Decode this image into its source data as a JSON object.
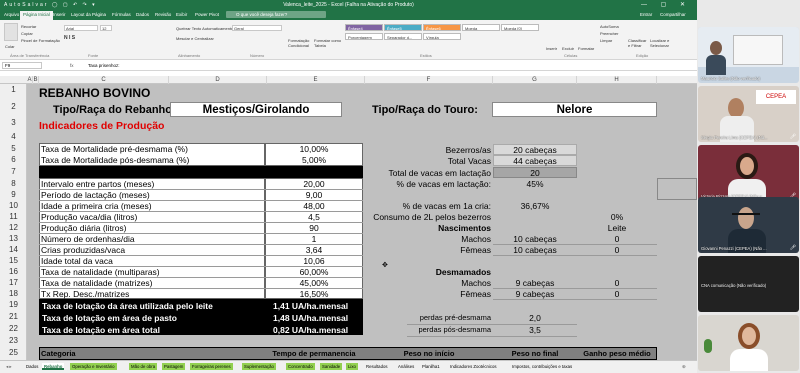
{
  "window": {
    "title": "Valenca_leite_2025 - Excel (Falha na Ativação do Produto)",
    "quick_access": "AutoSalvar ◯ ▢ ↶ ↷ ▾",
    "controls": "— ▢ ✕",
    "user_initial": "U"
  },
  "menu_tabs": [
    "Arquivo",
    "Página Inicial",
    "Inserir",
    "Layout da Página",
    "Fórmulas",
    "Dados",
    "Revisão",
    "Exibir",
    "Power Pivot"
  ],
  "search_placeholder": "O que você deseja fazer?",
  "right_tabs": {
    "enter": "Entrar",
    "share": "Compartilhar"
  },
  "ribbon": {
    "paste": "Colar",
    "cut": "Recortar",
    "copy": "Copiar",
    "format_painter": "Pincel de Formatação",
    "clipboard_group": "Área de Transferência",
    "font_name": "Arial",
    "font_size": "12",
    "font_group": "Fonte",
    "wrap": "Quebrar Texto Automaticamente",
    "merge": "Mesclar e Centralizar",
    "align_group": "Alinhamento",
    "number_format": "Geral",
    "number_group": "Número",
    "cond_format": "Formatação Condicional",
    "format_table": "Formatar como Tabela",
    "styles": [
      "Ênfase4",
      "Ênfase5",
      "Ênfase6",
      "Moeda",
      "Moeda [0]",
      "Porcentagem",
      "Separador d...",
      "Vírgula"
    ],
    "style_colors": [
      "#8064a2",
      "#4bacc6",
      "#f79646"
    ],
    "styles_group": "Estilos",
    "insert": "Inserir",
    "delete": "Excluir",
    "format": "Formatar",
    "cells_group": "Células",
    "autosum": "AutoSoma",
    "fill": "Preencher",
    "clear": "Limpar",
    "sort": "Classificar e Filtrar",
    "find": "Localizar e Selecionar",
    "edit_group": "Edição"
  },
  "formula_bar": {
    "name_box": "F9",
    "fx": "fx",
    "value": "Taxa prisenhoz:"
  },
  "columns": [
    "A",
    "B",
    "C",
    "D",
    "E",
    "F",
    "G",
    "H"
  ],
  "rows": [
    "1",
    "2",
    "3",
    "4",
    "5",
    "6",
    "7",
    "8",
    "9",
    "10",
    "11",
    "12",
    "13",
    "14",
    "15",
    "16",
    "17",
    "18",
    "19",
    "21",
    "22",
    "23",
    "24",
    "25"
  ],
  "sheet": {
    "title": "REBANHO BOVINO",
    "breed_label": "Tipo/Raça do Rebanho:",
    "breed_value": "Mestiços/Girolando",
    "bull_label": "Tipo/Raça do Touro:",
    "bull_value": "Nelore",
    "indicators_title": "Indicadores de Produção",
    "mortality_pre_label": "Taxa de Mortalidade pré-desmama (%)",
    "mortality_pre_value": "10,00%",
    "mortality_post_label": "Taxa de Mortalidade pós-desmama (%)",
    "mortality_post_value": "5,00%",
    "indicators": [
      {
        "label": "Intervalo entre partos (meses)",
        "value": "20,00"
      },
      {
        "label": "Período de lactação (meses)",
        "value": "9,00"
      },
      {
        "label": "Idade a primeira cria (meses)",
        "value": "48,00"
      },
      {
        "label": "Produção vaca/dia (litros)",
        "value": "4,5"
      },
      {
        "label": "Produção diária (litros)",
        "value": "90"
      },
      {
        "label": "Número de ordenhas/dia",
        "value": "1"
      },
      {
        "label": "Crias produzidas/vaca",
        "value": "3,64"
      },
      {
        "label": "Idade total da vaca",
        "value": "10,06"
      },
      {
        "label": "Taxa de natalidade (multiparas)",
        "value": "60,00%"
      },
      {
        "label": "Taxa de natalidade (matrizes)",
        "value": "45,00%"
      },
      {
        "label": "Tx Rep. Desc./matrizes",
        "value": "16,50%"
      }
    ],
    "stocking": [
      {
        "label": "Taxa de lotação da área utilizada pelo leite",
        "value": "1,41 UA/ha.mensal"
      },
      {
        "label": "Taxa de lotação em área de pasto",
        "value": "1,48 UA/ha.mensal"
      },
      {
        "label": "Taxa de lotação em área total",
        "value": "0,82 UA/ha.mensal"
      }
    ],
    "herd": [
      {
        "label": "Bezerros/as",
        "value": "20 cabeças"
      },
      {
        "label": "Total Vacas",
        "value": "44 cabeças"
      },
      {
        "label": "Total de vacas em lactação",
        "value": "20"
      },
      {
        "label": "% de vacas em lactação:",
        "value": "45%"
      }
    ],
    "first_calving_label": "% de vacas em 1a cria:",
    "first_calving_value": "36,67%",
    "calf_milk_label": "Consumo de 2L pelos bezerros",
    "calf_milk_value": "0%",
    "births_title": "Nascimentos",
    "births_unit": "Leite",
    "births": [
      {
        "label": "Machos",
        "value": "10 cabeças",
        "extra": "0"
      },
      {
        "label": "Fêmeas",
        "value": "10 cabeças",
        "extra": "0"
      }
    ],
    "weaned_title": "Desmamados",
    "weaned": [
      {
        "label": "Machos",
        "value": "9 cabeças",
        "extra": "0"
      },
      {
        "label": "Fêmeas",
        "value": "9 cabeças",
        "extra": "0"
      }
    ],
    "losses": [
      {
        "label": "perdas pré-desmama",
        "value": "2,0"
      },
      {
        "label": "perdas pós-desmama",
        "value": "3,5"
      }
    ],
    "table_header": [
      "Categoria",
      "Tempo de permanencia",
      "Peso no início",
      "Peso no final",
      "Ganho peso médio"
    ]
  },
  "sheet_tabs": [
    "Dados",
    "Rebanho",
    "Operação e Inventário",
    "Mão de obra",
    "Pastagem",
    "Forrageiras perenes",
    "Suplementação",
    "Concentrado",
    "Sanidade",
    "Lixo",
    "Resultados",
    "Análises",
    "Planilha1",
    "Indicadores Zootécnicos",
    "Impostos, contribuições e taxas"
  ],
  "active_sheet": "Rebanho",
  "participants": [
    {
      "name": "Mauricio Salles (Não verificado)",
      "bg": "#b7c8d8"
    },
    {
      "name": "Sérgio Pereira Lima (CEPEA) (Nã...",
      "bg": "#d8d0c8"
    },
    {
      "name": "Victoria Rizzato (CEPEA) (Não v...",
      "bg": "#7a2e3a"
    },
    {
      "name": "Giovanni Penazzi (CEPEA) (Não ...",
      "bg": "#2f3a46"
    },
    {
      "name": "CNA comunicação (Não verificado)",
      "bg": "#222222"
    },
    {
      "name": "",
      "bg": "#d9d6d0"
    }
  ]
}
